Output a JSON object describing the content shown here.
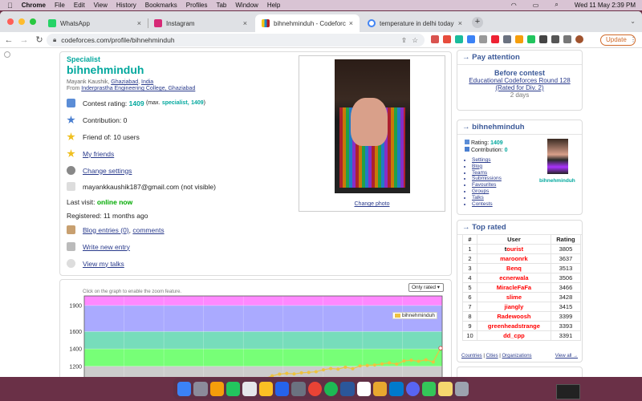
{
  "menubar": {
    "app": "Chrome",
    "items": [
      "File",
      "Edit",
      "View",
      "History",
      "Bookmarks",
      "Profiles",
      "Tab",
      "Window",
      "Help"
    ],
    "datetime": "Wed 11 May  2:39 PM"
  },
  "tabs": [
    {
      "title": "WhatsApp",
      "color": "#25d366"
    },
    {
      "title": "Instagram",
      "color": "#d62976"
    },
    {
      "title": "bihnehminduh - Codeforces",
      "color": "#1f8acb"
    },
    {
      "title": "temperature in delhi today - Goo",
      "color": "#4285f4"
    }
  ],
  "address": "codeforces.com/profile/bihnehminduh",
  "update_label": "Update",
  "profile": {
    "rank": "Specialist",
    "handle": "bihnehminduh",
    "name": "Mayank Kaushik",
    "city": "Ghaziabad",
    "country": "India",
    "from_label": "From",
    "org": "Inderprastha Engineering College, Ghaziabad",
    "rating_label": "Contest rating:",
    "rating": "1409",
    "max_pre": "(max.",
    "max_rank": "specialist,",
    "max_rating": "1409",
    "contribution_label": "Contribution:",
    "contribution": "0",
    "friend_label": "Friend of: 10 users",
    "my_friends": "My friends",
    "change_settings": "Change settings",
    "email": "mayankkaushik187@gmail.com (not visible)",
    "last_visit_label": "Last visit:",
    "last_visit": "online now",
    "registered": "Registered: 11 months ago",
    "blog": "Blog entries (0)",
    "comments": "comments",
    "write": "Write new entry",
    "talks": "View my talks",
    "change_photo": "Change photo"
  },
  "graph": {
    "hint": "Click on the graph to enable the zoom feature.",
    "select": "Only rated",
    "legend": "bihnehminduh"
  },
  "chart_data": {
    "type": "line",
    "yticks": [
      1200,
      1400,
      1600,
      1900
    ],
    "ylim": [
      1050,
      2010
    ],
    "bands": [
      {
        "from": 1900,
        "to": 2010,
        "color": "#ff88ff"
      },
      {
        "from": 1600,
        "to": 1900,
        "color": "#aaaaff"
      },
      {
        "from": 1400,
        "to": 1600,
        "color": "#77ddbb"
      },
      {
        "from": 1200,
        "to": 1400,
        "color": "#77ff77"
      },
      {
        "from": 1050,
        "to": 1200,
        "color": "#cccccc"
      }
    ],
    "series": [
      {
        "name": "bihnehminduh",
        "color": "#edc240",
        "values": [
          1060,
          1090,
          1110,
          1118,
          1112,
          1125,
          1130,
          1138,
          1160,
          1175,
          1168,
          1190,
          1172,
          1205,
          1210,
          1215,
          1228,
          1240,
          1225,
          1262,
          1270,
          1258,
          1275,
          1250,
          1409
        ]
      }
    ]
  },
  "pay_attention": {
    "title": "→ Pay attention",
    "before": "Before contest",
    "contest": "Educational Codeforces Round 128 (Rated for Div. 2)",
    "days": "2 days"
  },
  "mini": {
    "title": "→ bihnehminduh",
    "rating_label": "Rating:",
    "rating": "1409",
    "contrib_label": "Contribution:",
    "contrib": "0",
    "handle": "bihnehminduh",
    "links": [
      "Settings",
      "Blog",
      "Teams",
      "Submissions",
      "Favourites",
      "Groups",
      "Talks",
      "Contests"
    ]
  },
  "top": {
    "title": "→ Top rated",
    "headers": [
      "#",
      "User",
      "Rating"
    ],
    "rows": [
      {
        "n": "1",
        "first": "t",
        "rest": "ourist",
        "r": "3805",
        "fc": "#000000"
      },
      {
        "n": "2",
        "first": "m",
        "rest": "aroonrk",
        "r": "3637",
        "fc": "#ff0000"
      },
      {
        "n": "3",
        "first": "B",
        "rest": "enq",
        "r": "3513",
        "fc": "#ff0000"
      },
      {
        "n": "4",
        "first": "e",
        "rest": "cnerwala",
        "r": "3506",
        "fc": "#ff0000"
      },
      {
        "n": "5",
        "first": "M",
        "rest": "iracleFaFa",
        "r": "3466",
        "fc": "#ff0000"
      },
      {
        "n": "6",
        "first": "s",
        "rest": "lime",
        "r": "3428",
        "fc": "#ff0000"
      },
      {
        "n": "7",
        "first": "j",
        "rest": "iangly",
        "r": "3415",
        "fc": "#ff0000"
      },
      {
        "n": "8",
        "first": "R",
        "rest": "adewoosh",
        "r": "3399",
        "fc": "#ff0000"
      },
      {
        "n": "9",
        "first": "g",
        "rest": "reenheadstrange",
        "r": "3393",
        "fc": "#ff0000"
      },
      {
        "n": "10",
        "first": "d",
        "rest": "d_cpp",
        "r": "3391",
        "fc": "#ff0000"
      }
    ],
    "footer": [
      "Countries",
      "Cities",
      "Organizations"
    ],
    "all": "View all →"
  }
}
